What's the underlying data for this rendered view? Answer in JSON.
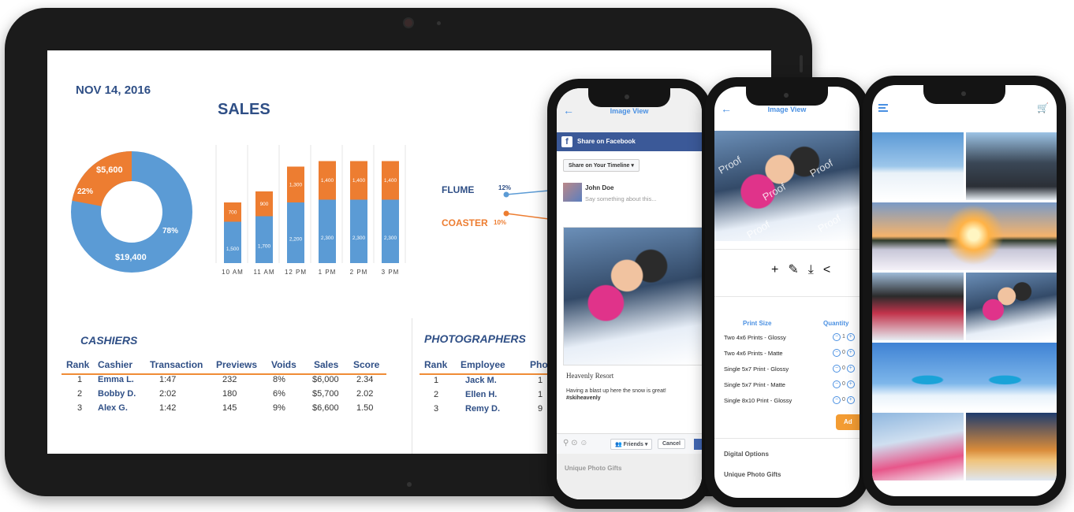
{
  "dashboard": {
    "date": "NOV 14, 2016",
    "sales_title": "SALES",
    "donut": {
      "big_value": "$19,400",
      "big_pct": "78%",
      "small_value": "$5,600",
      "small_pct": "22%",
      "colors": {
        "blue": "#5b9bd5",
        "orange": "#ed7d31"
      }
    },
    "chart_data": {
      "type": "bar",
      "categories": [
        "10 AM",
        "11 AM",
        "12 PM",
        "1 PM",
        "2 PM",
        "3 PM"
      ],
      "series": [
        {
          "values": [
            1500,
            1700,
            2200,
            2300,
            2300,
            2300
          ]
        },
        {
          "values": [
            700,
            900,
            1300,
            1400,
            1400,
            1400
          ]
        }
      ]
    },
    "legend": [
      {
        "label": "FLUME",
        "pct": "12%",
        "color": "#5b9bd5"
      },
      {
        "label": "COASTER",
        "pct": "10%",
        "color": "#ed7d31"
      }
    ],
    "cashiers": {
      "title": "CASHIERS",
      "columns": [
        "Rank",
        "Cashier",
        "Transaction",
        "Previews",
        "Voids",
        "Sales",
        "Score"
      ],
      "rows": [
        [
          "1",
          "Emma L.",
          "1:47",
          "232",
          "8%",
          "$6,000",
          "2.34"
        ],
        [
          "2",
          "Bobby D.",
          "2:02",
          "180",
          "6%",
          "$5,700",
          "2.02"
        ],
        [
          "3",
          "Alex G.",
          "1:42",
          "145",
          "9%",
          "$6,600",
          "1.50"
        ]
      ]
    },
    "photographers": {
      "title": "PHOTOGRAPHERS",
      "columns": [
        "Rank",
        "Employee",
        "Pho"
      ],
      "rows": [
        [
          "1",
          "Jack M.",
          "1"
        ],
        [
          "2",
          "Ellen H.",
          "1"
        ],
        [
          "3",
          "Remy D.",
          "9"
        ]
      ]
    }
  },
  "phone1": {
    "title": "Image View",
    "share_bar": "Share on Facebook",
    "timeline_select": "Share on Your Timeline",
    "user": "John Doe",
    "placeholder": "Say something about this...",
    "card_caption": "Heavenly Resort",
    "card_text": "Having a blast up here the snow is great!",
    "card_tag": "#skiheavenly",
    "btn_friends": "Friends",
    "btn_cancel": "Cancel",
    "footer": "Unique Photo Gifts"
  },
  "phone2": {
    "title": "Image View",
    "watermark": "Proof",
    "col_size": "Print Size",
    "col_qty": "Quantity",
    "prints": [
      {
        "name": "Two 4x6 Prints - Glossy",
        "qty": "1"
      },
      {
        "name": "Two 4x6 Prints - Matte",
        "qty": "0"
      },
      {
        "name": "Single 5x7 Print - Glossy",
        "qty": "0"
      },
      {
        "name": "Single 5x7 Print - Matte",
        "qty": "0"
      },
      {
        "name": "Single 8x10 Print - Glossy",
        "qty": "0"
      }
    ],
    "add_label": "Ad",
    "digital_options": "Digital Options",
    "unique_gifts": "Unique Photo Gifts"
  },
  "phone3": {
    "menu_icon": "menu-icon",
    "cart_icon": "cart-icon"
  }
}
